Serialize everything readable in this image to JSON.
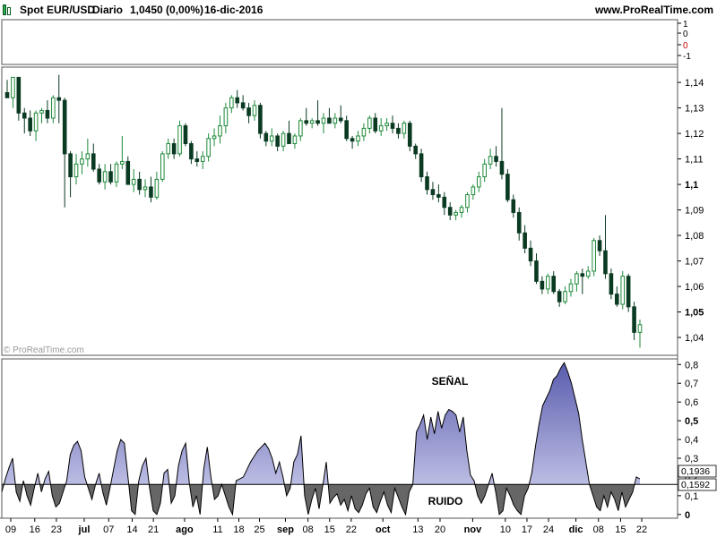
{
  "header": {
    "symbol": "Spot EUR/USD",
    "period": "Diario",
    "price": "1,0450 (0,00%)",
    "date": "16-dic-2016",
    "site": "www.ProRealTime.com"
  },
  "watermark": "© ProRealTime.com",
  "colors": {
    "up": "#1e8a3a",
    "down": "#0a3a22",
    "signal_fill": "#7d7fc0",
    "noise_fill": "#666666",
    "border": "#555555"
  },
  "chart_data": [
    {
      "type": "bar",
      "panel": "volume",
      "yticks": [
        "1",
        "0",
        "0",
        "-1"
      ],
      "ytick_colors": [
        "#000000",
        "#000000",
        "#cc0000",
        "#000000"
      ]
    },
    {
      "type": "candlestick",
      "panel": "price",
      "ylim": [
        1.033,
        1.146
      ],
      "yticks": [
        {
          "v": 1.14,
          "label": "1,14",
          "bold": false
        },
        {
          "v": 1.13,
          "label": "1,13",
          "bold": false
        },
        {
          "v": 1.12,
          "label": "1,12",
          "bold": false
        },
        {
          "v": 1.11,
          "label": "1,11",
          "bold": false
        },
        {
          "v": 1.1,
          "label": "1,1",
          "bold": true
        },
        {
          "v": 1.09,
          "label": "1,09",
          "bold": false
        },
        {
          "v": 1.08,
          "label": "1,08",
          "bold": false
        },
        {
          "v": 1.07,
          "label": "1,07",
          "bold": false
        },
        {
          "v": 1.06,
          "label": "1,06",
          "bold": false
        },
        {
          "v": 1.05,
          "label": "1,05",
          "bold": true
        },
        {
          "v": 1.04,
          "label": "1,04",
          "bold": false
        }
      ],
      "ohlc": [
        [
          1.136,
          1.141,
          1.134,
          1.134
        ],
        [
          1.134,
          1.142,
          1.13,
          1.142
        ],
        [
          1.142,
          1.142,
          1.125,
          1.128
        ],
        [
          1.128,
          1.13,
          1.12,
          1.126
        ],
        [
          1.126,
          1.129,
          1.119,
          1.121
        ],
        [
          1.121,
          1.129,
          1.117,
          1.128
        ],
        [
          1.128,
          1.13,
          1.124,
          1.129
        ],
        [
          1.129,
          1.133,
          1.124,
          1.126
        ],
        [
          1.126,
          1.135,
          1.124,
          1.134
        ],
        [
          1.134,
          1.143,
          1.124,
          1.133
        ],
        [
          1.133,
          1.134,
          1.091,
          1.112
        ],
        [
          1.112,
          1.113,
          1.095,
          1.103
        ],
        [
          1.103,
          1.112,
          1.1,
          1.108
        ],
        [
          1.108,
          1.113,
          1.104,
          1.11
        ],
        [
          1.11,
          1.118,
          1.107,
          1.112
        ],
        [
          1.112,
          1.116,
          1.105,
          1.106
        ],
        [
          1.106,
          1.108,
          1.1,
          1.101
        ],
        [
          1.101,
          1.108,
          1.098,
          1.105
        ],
        [
          1.105,
          1.108,
          1.1,
          1.101
        ],
        [
          1.101,
          1.109,
          1.099,
          1.108
        ],
        [
          1.108,
          1.119,
          1.106,
          1.109
        ],
        [
          1.109,
          1.111,
          1.1,
          1.1
        ],
        [
          1.1,
          1.106,
          1.097,
          1.102
        ],
        [
          1.102,
          1.105,
          1.096,
          1.098
        ],
        [
          1.098,
          1.102,
          1.095,
          1.099
        ],
        [
          1.099,
          1.103,
          1.093,
          1.095
        ],
        [
          1.095,
          1.105,
          1.094,
          1.102
        ],
        [
          1.102,
          1.113,
          1.101,
          1.112
        ],
        [
          1.112,
          1.118,
          1.11,
          1.116
        ],
        [
          1.116,
          1.118,
          1.11,
          1.112
        ],
        [
          1.112,
          1.125,
          1.111,
          1.123
        ],
        [
          1.123,
          1.124,
          1.115,
          1.116
        ],
        [
          1.116,
          1.117,
          1.108,
          1.11
        ],
        [
          1.11,
          1.113,
          1.107,
          1.109
        ],
        [
          1.109,
          1.113,
          1.106,
          1.111
        ],
        [
          1.111,
          1.12,
          1.109,
          1.118
        ],
        [
          1.118,
          1.122,
          1.115,
          1.119
        ],
        [
          1.119,
          1.127,
          1.116,
          1.123
        ],
        [
          1.123,
          1.132,
          1.12,
          1.13
        ],
        [
          1.13,
          1.135,
          1.128,
          1.134
        ],
        [
          1.134,
          1.137,
          1.13,
          1.132
        ],
        [
          1.132,
          1.135,
          1.129,
          1.13
        ],
        [
          1.13,
          1.132,
          1.124,
          1.127
        ],
        [
          1.127,
          1.133,
          1.125,
          1.131
        ],
        [
          1.131,
          1.132,
          1.118,
          1.12
        ],
        [
          1.12,
          1.121,
          1.115,
          1.117
        ],
        [
          1.117,
          1.122,
          1.115,
          1.119
        ],
        [
          1.119,
          1.12,
          1.113,
          1.115
        ],
        [
          1.115,
          1.121,
          1.113,
          1.12
        ],
        [
          1.12,
          1.125,
          1.117,
          1.116
        ],
        [
          1.116,
          1.12,
          1.114,
          1.119
        ],
        [
          1.119,
          1.126,
          1.117,
          1.125
        ],
        [
          1.125,
          1.13,
          1.123,
          1.124
        ],
        [
          1.124,
          1.126,
          1.122,
          1.125
        ],
        [
          1.125,
          1.133,
          1.123,
          1.124
        ],
        [
          1.124,
          1.128,
          1.12,
          1.126
        ],
        [
          1.126,
          1.13,
          1.124,
          1.124
        ],
        [
          1.124,
          1.128,
          1.122,
          1.126
        ],
        [
          1.126,
          1.131,
          1.124,
          1.125
        ],
        [
          1.125,
          1.127,
          1.117,
          1.118
        ],
        [
          1.118,
          1.119,
          1.114,
          1.117
        ],
        [
          1.117,
          1.121,
          1.115,
          1.119
        ],
        [
          1.119,
          1.124,
          1.117,
          1.122
        ],
        [
          1.122,
          1.127,
          1.12,
          1.126
        ],
        [
          1.126,
          1.128,
          1.12,
          1.121
        ],
        [
          1.121,
          1.126,
          1.119,
          1.123
        ],
        [
          1.123,
          1.126,
          1.121,
          1.124
        ],
        [
          1.124,
          1.127,
          1.12,
          1.122
        ],
        [
          1.122,
          1.124,
          1.118,
          1.12
        ],
        [
          1.12,
          1.125,
          1.118,
          1.124
        ],
        [
          1.124,
          1.125,
          1.113,
          1.115
        ],
        [
          1.115,
          1.116,
          1.11,
          1.112
        ],
        [
          1.112,
          1.114,
          1.101,
          1.103
        ],
        [
          1.103,
          1.105,
          1.096,
          1.098
        ],
        [
          1.098,
          1.101,
          1.094,
          1.096
        ],
        [
          1.096,
          1.1,
          1.093,
          1.095
        ],
        [
          1.095,
          1.097,
          1.088,
          1.091
        ],
        [
          1.091,
          1.093,
          1.086,
          1.088
        ],
        [
          1.088,
          1.09,
          1.086,
          1.089
        ],
        [
          1.089,
          1.092,
          1.087,
          1.091
        ],
        [
          1.091,
          1.097,
          1.089,
          1.096
        ],
        [
          1.096,
          1.1,
          1.094,
          1.099
        ],
        [
          1.099,
          1.105,
          1.097,
          1.103
        ],
        [
          1.103,
          1.11,
          1.101,
          1.108
        ],
        [
          1.108,
          1.114,
          1.106,
          1.111
        ],
        [
          1.111,
          1.115,
          1.107,
          1.109
        ],
        [
          1.109,
          1.13,
          1.102,
          1.104
        ],
        [
          1.104,
          1.106,
          1.093,
          1.094
        ],
        [
          1.094,
          1.096,
          1.087,
          1.089
        ],
        [
          1.089,
          1.091,
          1.078,
          1.081
        ],
        [
          1.081,
          1.084,
          1.073,
          1.075
        ],
        [
          1.075,
          1.078,
          1.068,
          1.07
        ],
        [
          1.07,
          1.073,
          1.061,
          1.062
        ],
        [
          1.062,
          1.064,
          1.057,
          1.059
        ],
        [
          1.059,
          1.065,
          1.057,
          1.064
        ],
        [
          1.064,
          1.066,
          1.057,
          1.058
        ],
        [
          1.058,
          1.059,
          1.052,
          1.054
        ],
        [
          1.054,
          1.06,
          1.053,
          1.058
        ],
        [
          1.058,
          1.063,
          1.056,
          1.061
        ],
        [
          1.061,
          1.066,
          1.058,
          1.065
        ],
        [
          1.065,
          1.067,
          1.057,
          1.064
        ],
        [
          1.064,
          1.068,
          1.063,
          1.066
        ],
        [
          1.066,
          1.079,
          1.064,
          1.078
        ],
        [
          1.078,
          1.08,
          1.072,
          1.074
        ],
        [
          1.074,
          1.088,
          1.063,
          1.065
        ],
        [
          1.065,
          1.067,
          1.055,
          1.057
        ],
        [
          1.057,
          1.06,
          1.052,
          1.053
        ],
        [
          1.053,
          1.066,
          1.051,
          1.064
        ],
        [
          1.064,
          1.065,
          1.05,
          1.052
        ],
        [
          1.052,
          1.054,
          1.039,
          1.042
        ],
        [
          1.042,
          1.047,
          1.036,
          1.045
        ]
      ]
    },
    {
      "type": "area",
      "panel": "indicator",
      "ylim": [
        -0.02,
        0.83
      ],
      "yticks": [
        {
          "v": 0.8,
          "label": "0,8",
          "bold": false
        },
        {
          "v": 0.7,
          "label": "0,7",
          "bold": false
        },
        {
          "v": 0.6,
          "label": "0,6",
          "bold": false
        },
        {
          "v": 0.5,
          "label": "0,5",
          "bold": true
        },
        {
          "v": 0.4,
          "label": "0,4",
          "bold": false
        },
        {
          "v": 0.3,
          "label": "0,3",
          "bold": false
        },
        {
          "v": 0.2,
          "label": "0,2",
          "bold": false
        },
        {
          "v": 0.1,
          "label": "0,1",
          "bold": false
        },
        {
          "v": 0.0,
          "label": "0",
          "bold": true
        }
      ],
      "baseline": 0.16,
      "value_labels": [
        "0,1936",
        "0,1592"
      ],
      "annotations": [
        "SEÑAL",
        "RUIDO"
      ],
      "series": [
        {
          "values": [
            0.12,
            0.19,
            0.25,
            0.3,
            0.12,
            0.07,
            0.18,
            0.1,
            0.05,
            0.14,
            0.22,
            0.12,
            0.19,
            0.23,
            0.1,
            0.04,
            0.06,
            0.12,
            0.18,
            0.32,
            0.37,
            0.39,
            0.34,
            0.2,
            0.14,
            0.08,
            0.16,
            0.22,
            0.12,
            0.05,
            0.14,
            0.24,
            0.34,
            0.4,
            0.38,
            0.2,
            0.02,
            0.0,
            0.18,
            0.26,
            0.3,
            0.14,
            0.02,
            0.0,
            0.06,
            0.22,
            0.24,
            0.06,
            0.1,
            0.26,
            0.34,
            0.38,
            0.17,
            0.04,
            0.1,
            0.0,
            0.24,
            0.36,
            0.2,
            0.08,
            0.1,
            0.16,
            0.1,
            0.04,
            0.0,
            0.18,
            0.19,
            0.2,
            0.24,
            0.28,
            0.31,
            0.34,
            0.36,
            0.38,
            0.35,
            0.3,
            0.22,
            0.28,
            0.2,
            0.1,
            0.14,
            0.28,
            0.32,
            0.42,
            0.1,
            0.0,
            0.08,
            0.14,
            0.03,
            0.15,
            0.28,
            0.06,
            0.09,
            0.11,
            0.05,
            0.08,
            0.02,
            0.1,
            0.03,
            0.01,
            0.05,
            0.11,
            0.14,
            0.04,
            0.01,
            0.07,
            0.12,
            0.05,
            0.01,
            0.14,
            0.09,
            0.04,
            0.0,
            0.12,
            0.16,
            0.44,
            0.48,
            0.53,
            0.4,
            0.52,
            0.43,
            0.55,
            0.46,
            0.53,
            0.56,
            0.55,
            0.53,
            0.44,
            0.52,
            0.34,
            0.21,
            0.18,
            0.1,
            0.06,
            0.1,
            0.16,
            0.22,
            0.12,
            0.0,
            0.02,
            0.14,
            0.1,
            0.05,
            0.02,
            0.0,
            0.1,
            0.14,
            0.22,
            0.36,
            0.48,
            0.58,
            0.62,
            0.66,
            0.72,
            0.74,
            0.78,
            0.81,
            0.76,
            0.7,
            0.62,
            0.54,
            0.4,
            0.28,
            0.16,
            0.1,
            0.04,
            0.02,
            0.1,
            0.04,
            0.12,
            0.08,
            0.02,
            0.12,
            0.04,
            0.08,
            0.12,
            0.2,
            0.19
          ]
        }
      ]
    }
  ],
  "x_axis": {
    "labels": [
      {
        "t": 0.0,
        "label": "09",
        "bold": false
      },
      {
        "t": 0.05,
        "label": "16",
        "bold": false
      },
      {
        "t": 0.095,
        "label": "23",
        "bold": false
      },
      {
        "t": 0.153,
        "label": "jul",
        "bold": true
      },
      {
        "t": 0.204,
        "label": "07",
        "bold": false
      },
      {
        "t": 0.253,
        "label": "14",
        "bold": false
      },
      {
        "t": 0.297,
        "label": "21",
        "bold": false
      },
      {
        "t": 0.362,
        "label": "ago",
        "bold": true
      },
      {
        "t": 0.431,
        "label": "11",
        "bold": false
      },
      {
        "t": 0.475,
        "label": "18",
        "bold": false
      },
      {
        "t": 0.518,
        "label": "25",
        "bold": false
      },
      {
        "t": 0.572,
        "label": "sep",
        "bold": true
      },
      {
        "t": 0.619,
        "label": "08",
        "bold": false
      },
      {
        "t": 0.664,
        "label": "15",
        "bold": false
      },
      {
        "t": 0.709,
        "label": "22",
        "bold": false
      },
      {
        "t": 0.775,
        "label": "oct",
        "bold": true
      },
      {
        "t": 0.848,
        "label": "13",
        "bold": false
      },
      {
        "t": 0.894,
        "label": "20",
        "bold": false
      },
      {
        "t": 0.962,
        "label": "nov",
        "bold": true
      },
      {
        "t": 1.03,
        "label": "10",
        "bold": false
      },
      {
        "t": 1.075,
        "label": "17",
        "bold": false
      },
      {
        "t": 1.12,
        "label": "24",
        "bold": false
      },
      {
        "t": 1.177,
        "label": "dic",
        "bold": true
      },
      {
        "t": 1.224,
        "label": "08",
        "bold": false
      },
      {
        "t": 1.27,
        "label": "15",
        "bold": false
      },
      {
        "t": 1.314,
        "label": "22",
        "bold": false
      }
    ]
  }
}
